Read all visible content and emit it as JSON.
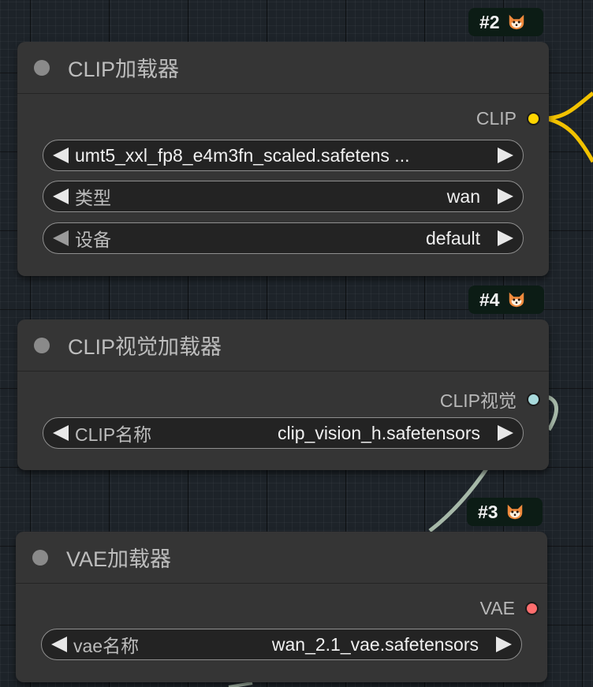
{
  "nodes": [
    {
      "badge": "#2",
      "badge_icon": "fox-icon",
      "title": "CLIP加载器",
      "output": {
        "label": "CLIP",
        "color": "#ffd500"
      },
      "widgets": [
        {
          "value": "umt5_xxl_fp8_e4m3fn_scaled.safetens ..."
        },
        {
          "label": "类型",
          "value": "wan"
        },
        {
          "label": "设备",
          "value": "default"
        }
      ]
    },
    {
      "badge": "#4",
      "badge_icon": "fox-icon",
      "title": "CLIP视觉加载器",
      "output": {
        "label": "CLIP视觉",
        "color": "#a8dadc"
      },
      "widgets": [
        {
          "label": "CLIP名称",
          "value": "clip_vision_h.safetensors"
        }
      ]
    },
    {
      "badge": "#3",
      "badge_icon": "fox-icon",
      "title": "VAE加载器",
      "output": {
        "label": "VAE",
        "color": "#ff6e6e"
      },
      "widgets": [
        {
          "label": "vae名称",
          "value": "wan_2.1_vae.safetensors"
        }
      ]
    }
  ],
  "colors": {
    "clip_wire": "#f2c200",
    "clip_vision_wire": "#a6b8a8",
    "canvas": "#1d2329",
    "node_bg": "#353535"
  }
}
